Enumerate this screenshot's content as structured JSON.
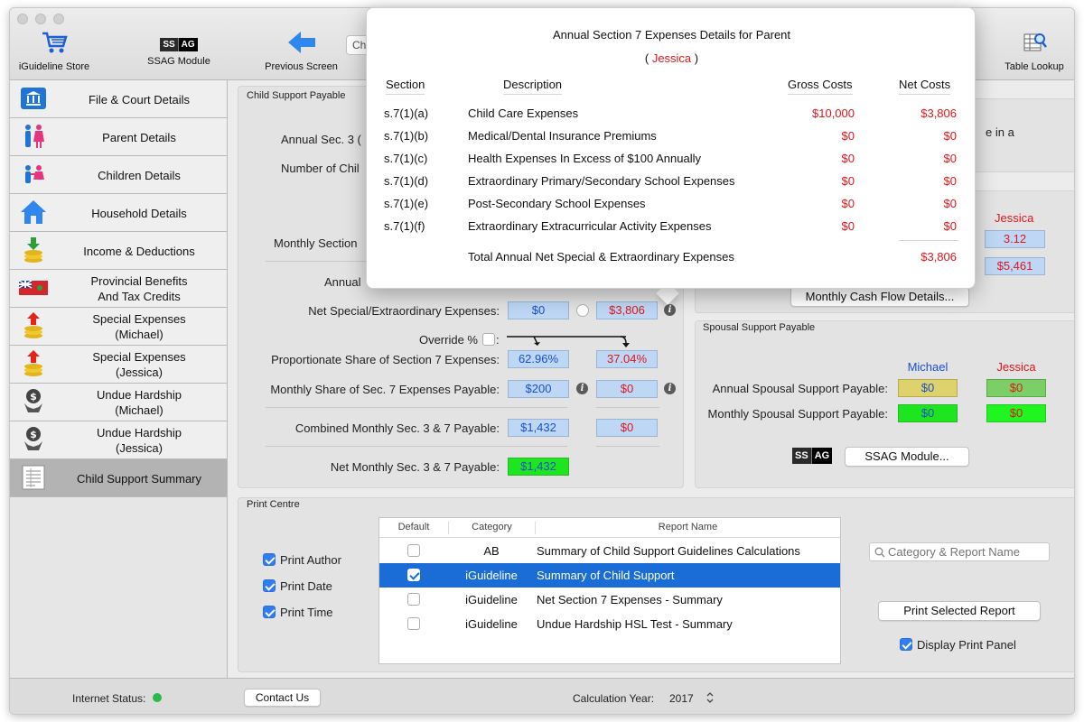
{
  "toolbar": {
    "store_label": "iGuideline Store",
    "ssag_label": "SSAG Module",
    "ssag_logo_left": "SS",
    "ssag_logo_right": "AG",
    "previous_label": "Previous Screen",
    "search_value": "Ch",
    "table_lookup_label": "Table Lookup"
  },
  "sidebar": {
    "items": [
      {
        "label": "File & Court Details",
        "icon": "courthouse-icon"
      },
      {
        "label": "Parent Details",
        "icon": "parents-icon"
      },
      {
        "label": "Children Details",
        "icon": "children-icon"
      },
      {
        "label": "Household Details",
        "icon": "house-icon"
      },
      {
        "label": "Income & Deductions",
        "icon": "coins-down-icon"
      },
      {
        "label": "Provincial Benefits\nAnd Tax Credits",
        "icon": "ontario-flag-icon"
      },
      {
        "label": "Special Expenses\n(Michael)",
        "icon": "coins-up-icon"
      },
      {
        "label": "Special Expenses\n(Jessica)",
        "icon": "coins-up-icon"
      },
      {
        "label": "Undue Hardship\n(Michael)",
        "icon": "hardship-icon"
      },
      {
        "label": "Undue Hardship\n(Jessica)",
        "icon": "hardship-icon"
      },
      {
        "label": "Child Support Summary",
        "icon": "summary-sheet-icon"
      }
    ]
  },
  "child_support": {
    "panel_title": "Child Support Payable",
    "annual_sec3_label": "Annual Sec. 3 (",
    "number_children_label": "Number of Chil",
    "monthly_section_label": "Monthly Section",
    "annual_label": "Annual",
    "net_special_label": "Net Special/Extraordinary Expenses:",
    "net_special_michael": "$0",
    "net_special_jessica": "$3,806",
    "override_label": "Override %",
    "override_colon": ":",
    "prop_share_label": "Proportionate Share of Section 7 Expenses:",
    "prop_share_michael": "62.96%",
    "prop_share_jessica": "37.04%",
    "monthly_share_label": "Monthly Share of Sec. 7 Expenses Payable:",
    "monthly_share_michael": "$200",
    "monthly_share_jessica": "$0",
    "combined_label": "Combined Monthly Sec. 3  & 7 Payable:",
    "combined_michael": "$1,432",
    "combined_jessica": "$0",
    "net_monthly_label": "Net Monthly Sec. 3  & 7 Payable:",
    "net_monthly_michael": "$1,432"
  },
  "right_top": {
    "partial_text": "e in a",
    "jessica_header": "Jessica",
    "value_1": "3.12",
    "value_2": "$5,461",
    "cash_flow_button": "Monthly Cash Flow Details..."
  },
  "spousal": {
    "panel_title": "Spousal Support Payable",
    "michael_header": "Michael",
    "jessica_header": "Jessica",
    "annual_label": "Annual Spousal Support Payable:",
    "annual_michael": "$0",
    "annual_jessica": "$0",
    "monthly_label": "Monthly Spousal Support Payable:",
    "monthly_michael": "$0",
    "monthly_jessica": "$0",
    "ssag_logo_left": "SS",
    "ssag_logo_right": "AG",
    "ssag_button": "SSAG  Module..."
  },
  "print_centre": {
    "panel_title": "Print Centre",
    "print_author": "Print Author",
    "print_date": "Print Date",
    "print_time": "Print Time",
    "columns": {
      "default": "Default",
      "category": "Category",
      "report_name": "Report Name"
    },
    "rows": [
      {
        "checked": false,
        "category": "AB",
        "name": "Summary of Child Support Guidelines Calculations",
        "selected": false
      },
      {
        "checked": true,
        "category": "iGuideline",
        "name": "Summary of Child Support",
        "selected": true
      },
      {
        "checked": false,
        "category": "iGuideline",
        "name": "Net Section 7 Expenses - Summary",
        "selected": false
      },
      {
        "checked": false,
        "category": "iGuideline",
        "name": "Undue Hardship HSL Test - Summary",
        "selected": false
      }
    ],
    "search_placeholder": "Category & Report Name",
    "print_button": "Print Selected Report",
    "display_panel_label": "Display Print Panel"
  },
  "statusbar": {
    "internet_label": "Internet Status:",
    "internet_color": "#2cb84a",
    "contact_button": "Contact Us",
    "calc_year_label": "Calculation Year:",
    "calc_year_value": "2017"
  },
  "popover": {
    "title": "Annual Section 7 Expenses Details for Parent",
    "paren_open": "( ",
    "parent_name": "Jessica",
    "paren_close": " )",
    "headers": {
      "section": "Section",
      "description": "Description",
      "gross": "Gross Costs",
      "net": "Net  Costs"
    },
    "rows": [
      {
        "section": "s.7(1)(a)",
        "description": "Child Care Expenses",
        "gross": "$10,000",
        "net": "$3,806"
      },
      {
        "section": "s.7(1)(b)",
        "description": "Medical/Dental Insurance Premiums",
        "gross": "$0",
        "net": "$0"
      },
      {
        "section": "s.7(1)(c)",
        "description": "Health Expenses In Excess of $100 Annually",
        "gross": "$0",
        "net": "$0"
      },
      {
        "section": "s.7(1)(d)",
        "description": "Extraordinary Primary/Secondary School Expenses",
        "gross": "$0",
        "net": "$0"
      },
      {
        "section": "s.7(1)(e)",
        "description": "Post-Secondary School Expenses",
        "gross": "$0",
        "net": "$0"
      },
      {
        "section": "s.7(1)(f)",
        "description": "Extraordinary Extracurricular Activity Expenses",
        "gross": "$0",
        "net": "$0"
      }
    ],
    "total_label": "Total Annual Net Special & Extraordinary Expenses",
    "total_value": "$3,806"
  }
}
